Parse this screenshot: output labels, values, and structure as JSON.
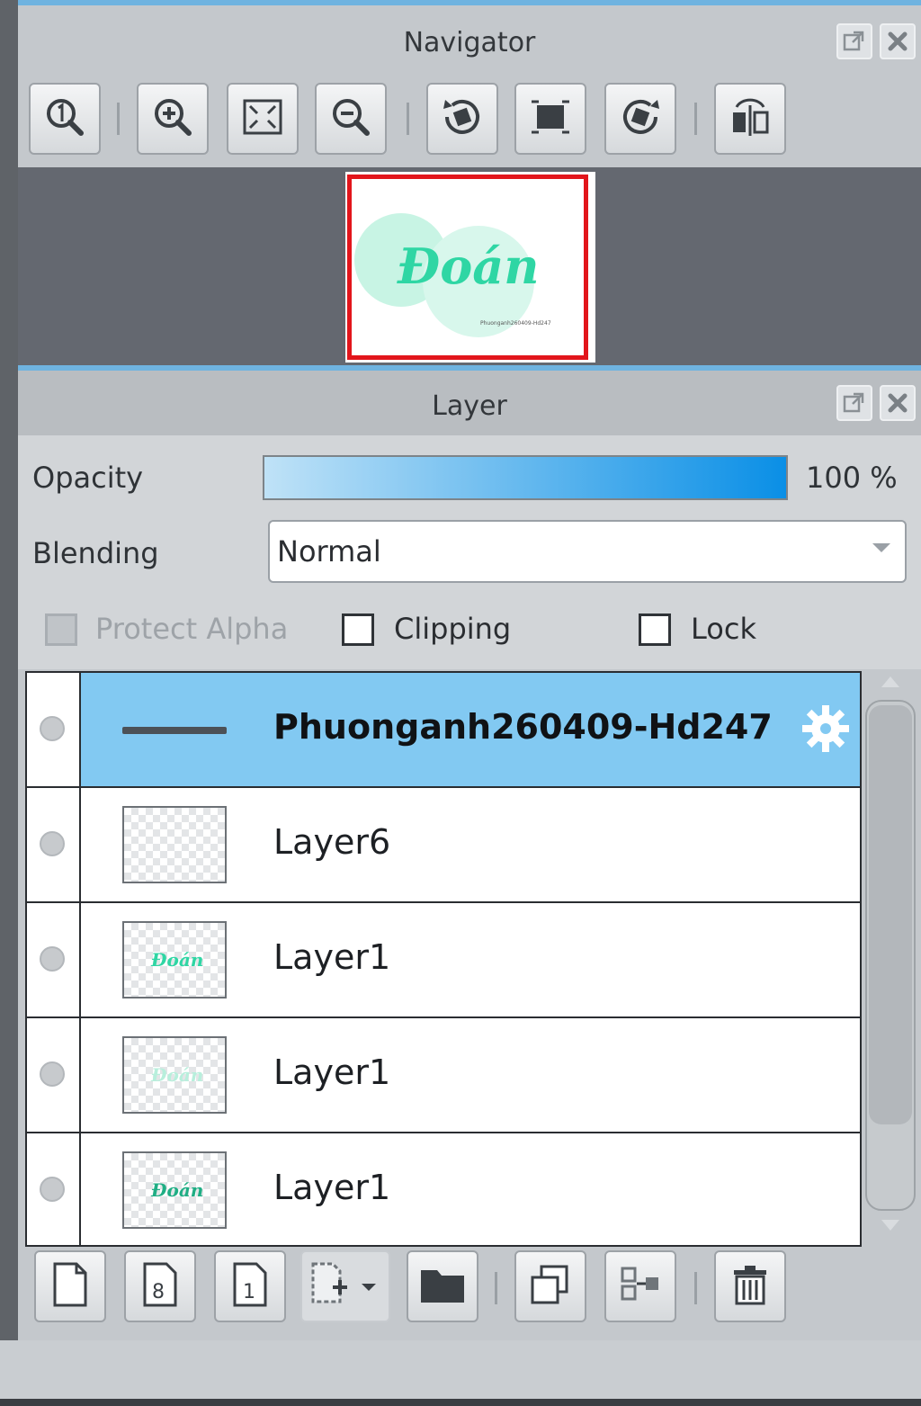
{
  "navigator": {
    "title": "Navigator",
    "toolbar": [
      {
        "icon": "zoom-actual-icon"
      },
      {
        "icon": "zoom-in-icon"
      },
      {
        "icon": "fit-screen-icon"
      },
      {
        "icon": "zoom-out-icon"
      },
      {
        "icon": "rotate-left-icon"
      },
      {
        "icon": "reset-rotation-icon"
      },
      {
        "icon": "rotate-right-icon"
      },
      {
        "icon": "flip-horizontal-icon"
      }
    ],
    "preview": {
      "text": "Đoán",
      "caption": "Phuonganh260409-Hd247"
    }
  },
  "layer_panel": {
    "title": "Layer",
    "opacity_label": "Opacity",
    "opacity_value": "100 %",
    "opacity_level": 1.0,
    "blending_label": "Blending",
    "blending_value": "Normal",
    "protect_alpha_label": "Protect Alpha",
    "clipping_label": "Clipping",
    "lock_label": "Lock",
    "layers": [
      {
        "name": "Phuonganh260409-Hd247",
        "selected": true,
        "thumb": "text-line"
      },
      {
        "name": "Layer6",
        "selected": false,
        "thumb": "empty"
      },
      {
        "name": "Layer1",
        "selected": false,
        "thumb": "doan-dark"
      },
      {
        "name": "Layer1",
        "selected": false,
        "thumb": "doan-light"
      },
      {
        "name": "Layer1",
        "selected": false,
        "thumb": "doan-dark"
      }
    ],
    "bottom_toolbar": [
      {
        "icon": "new-layer-icon"
      },
      {
        "icon": "new-8bit-layer-icon"
      },
      {
        "icon": "new-1bit-layer-icon"
      },
      {
        "icon": "add-layer-dropdown-icon"
      },
      {
        "icon": "folder-icon"
      },
      {
        "icon": "duplicate-layer-icon"
      },
      {
        "icon": "merge-layer-icon"
      },
      {
        "icon": "delete-layer-icon"
      }
    ]
  },
  "colors": {
    "accent": "#6fb3e0",
    "selection": "#82c9f2",
    "frame": "#e2151b",
    "brand_text": "#2fd6a4"
  }
}
